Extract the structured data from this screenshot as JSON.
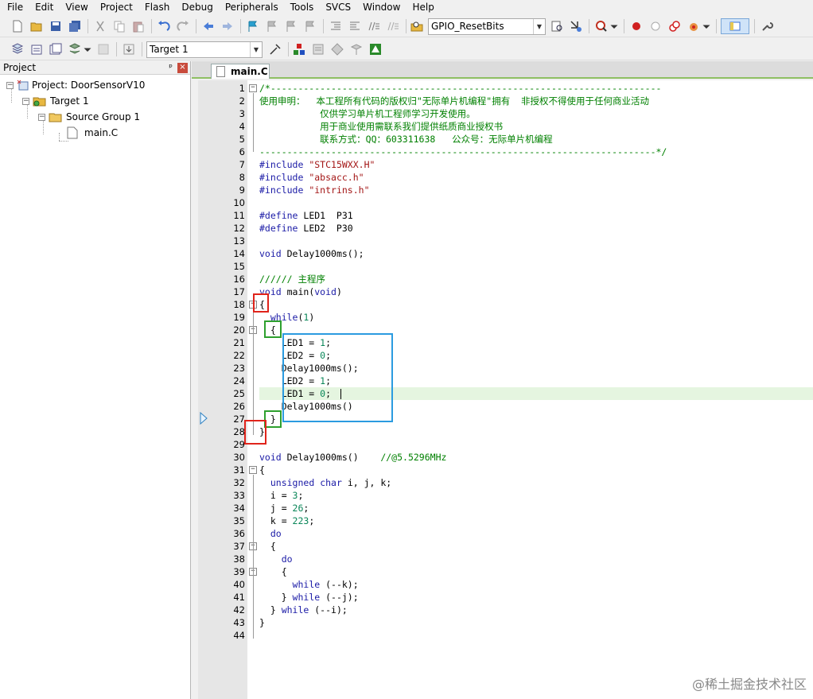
{
  "menu": [
    "File",
    "Edit",
    "View",
    "Project",
    "Flash",
    "Debug",
    "Peripherals",
    "Tools",
    "SVCS",
    "Window",
    "Help"
  ],
  "toolbar": {
    "function_combo": "GPIO_ResetBits",
    "target_combo": "Target 1"
  },
  "project_panel": {
    "title": "Project",
    "project": "Project: DoorSensorV10",
    "target": "Target 1",
    "group": "Source Group 1",
    "file": "main.C"
  },
  "editor": {
    "tab": "main.C",
    "lines": [
      {
        "n": "1",
        "t": "/*-----------------------------------------------------------------------"
      },
      {
        "n": "2",
        "t": "使用申明：  本工程所有代码的版权归\"无际单片机编程\"拥有  非授权不得使用于任何商业活动"
      },
      {
        "n": "3",
        "t": "           仅供学习单片机工程师学习开发使用。"
      },
      {
        "n": "4",
        "t": "           用于商业使用需联系我们提供纸质商业授权书"
      },
      {
        "n": "5",
        "t": "           联系方式：QQ：603311638   公众号：无际单片机编程"
      },
      {
        "n": "6",
        "t": "------------------------------------------------------------------------*/"
      },
      {
        "n": "7",
        "t": "#include \"STC15WXX.H\""
      },
      {
        "n": "8",
        "t": "#include \"absacc.h\""
      },
      {
        "n": "9",
        "t": "#include \"intrins.h\""
      },
      {
        "n": "10",
        "t": ""
      },
      {
        "n": "11",
        "t": "#define LED1  P31"
      },
      {
        "n": "12",
        "t": "#define LED2  P30"
      },
      {
        "n": "13",
        "t": ""
      },
      {
        "n": "14",
        "t": "void Delay1000ms();"
      },
      {
        "n": "15",
        "t": ""
      },
      {
        "n": "16",
        "t": "////// 主程序"
      },
      {
        "n": "17",
        "t": "void main(void)"
      },
      {
        "n": "18",
        "t": "{"
      },
      {
        "n": "19",
        "t": "  while(1)"
      },
      {
        "n": "20",
        "t": "  {"
      },
      {
        "n": "21",
        "t": "    LED1 = 1;"
      },
      {
        "n": "22",
        "t": "    LED2 = 0;"
      },
      {
        "n": "23",
        "t": "    Delay1000ms();"
      },
      {
        "n": "24",
        "t": "    LED2 = 1;"
      },
      {
        "n": "25",
        "t": "    LED1 = 0;"
      },
      {
        "n": "26",
        "t": "    Delay1000ms()"
      },
      {
        "n": "27",
        "t": "  }"
      },
      {
        "n": "28",
        "t": "}"
      },
      {
        "n": "29",
        "t": ""
      },
      {
        "n": "30",
        "t": "void Delay1000ms()    //@5.5296MHz"
      },
      {
        "n": "31",
        "t": "{"
      },
      {
        "n": "32",
        "t": "  unsigned char i, j, k;"
      },
      {
        "n": "33",
        "t": "  i = 3;"
      },
      {
        "n": "34",
        "t": "  j = 26;"
      },
      {
        "n": "35",
        "t": "  k = 223;"
      },
      {
        "n": "36",
        "t": "  do"
      },
      {
        "n": "37",
        "t": "  {"
      },
      {
        "n": "38",
        "t": "    do"
      },
      {
        "n": "39",
        "t": "    {"
      },
      {
        "n": "40",
        "t": "      while (--k);"
      },
      {
        "n": "41",
        "t": "    } while (--j);"
      },
      {
        "n": "42",
        "t": "  } while (--i);"
      },
      {
        "n": "43",
        "t": "}"
      },
      {
        "n": "44",
        "t": ""
      }
    ]
  },
  "watermark": "@稀土掘金技术社区",
  "colors": {
    "box_red": "#e0241b",
    "box_green": "#2ea02e",
    "box_blue": "#2b9be0",
    "highlight_line": "#e5f5e0"
  }
}
